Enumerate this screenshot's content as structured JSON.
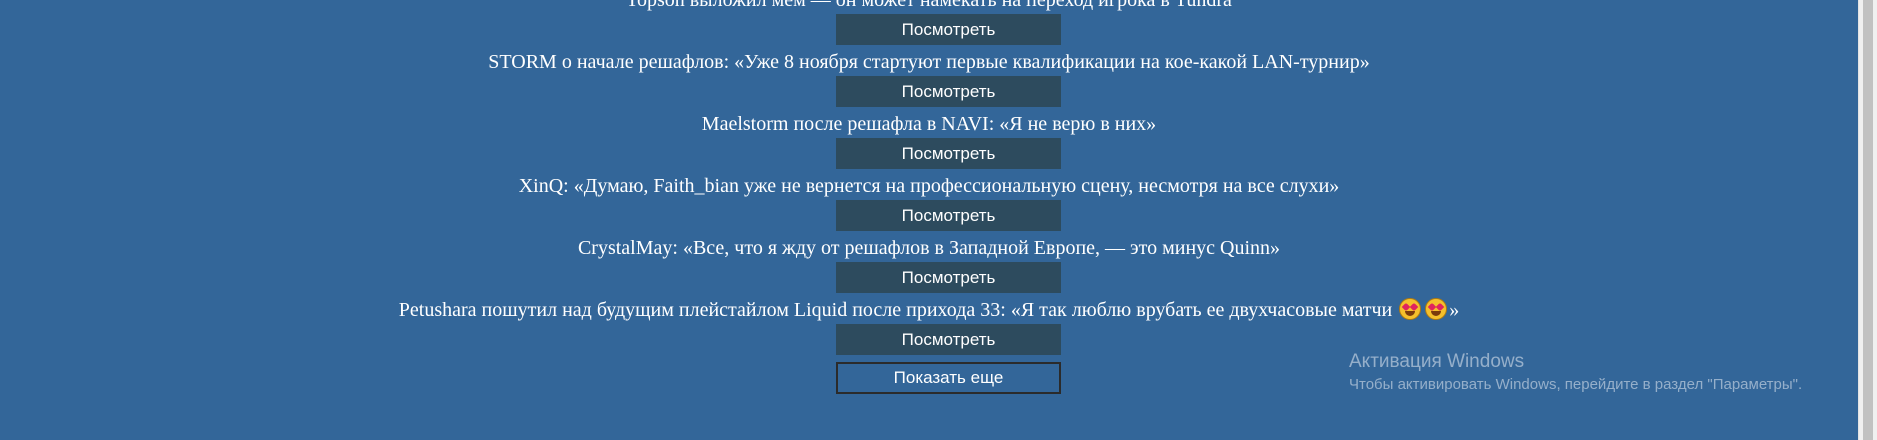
{
  "news": [
    {
      "headline": "Topson выложил мем — он может намекать на переход игрока в Tundra",
      "button": "Посмотреть"
    },
    {
      "headline": "STORM о начале решафлов: «Уже 8 ноября стартуют первые квалификации на кое-какой LAN-турнир»",
      "button": "Посмотреть"
    },
    {
      "headline": "Maelstorm после решафла в NAVI: «Я не верю в них»",
      "button": "Посмотреть"
    },
    {
      "headline": "XinQ: «Думаю, Faith_bian уже не вернется на профессиональную сцену, несмотря на все слухи»",
      "button": "Посмотреть"
    },
    {
      "headline": "CrystalMay: «Все, что я жду от решафлов в Западной Европе, — это минус Quinn»",
      "button": "Посмотреть"
    },
    {
      "headline_text": "Petushara пошутил над будущим плейстайлом Liquid после прихода 33: «Я так люблю врубать ее двухчасовые матчи",
      "headline_end": "»",
      "emoji": "star-struck-emoji",
      "button": "Посмотреть"
    }
  ],
  "load_more_label": "Показать еще",
  "watermark": {
    "title": "Активация Windows",
    "subtitle": "Чтобы активировать Windows, перейдите в раздел \"Параметры\"."
  },
  "colors": {
    "background": "#336699",
    "button": "#2d4b5e",
    "text": "#ffffff"
  }
}
